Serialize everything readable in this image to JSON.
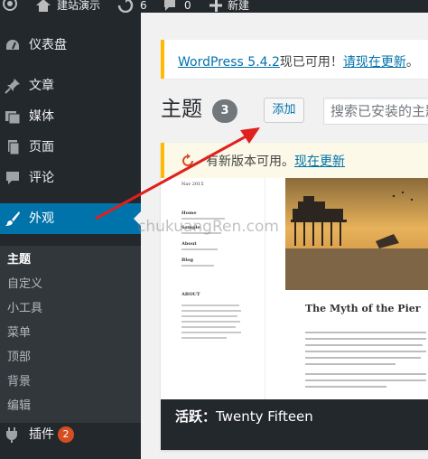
{
  "admin_bar": {
    "site_name": "建站演示",
    "updates_count": "6",
    "comments_count": "0",
    "new_label": "新建"
  },
  "sidebar": {
    "dashboard": "仪表盘",
    "posts": "文章",
    "media": "媒体",
    "pages": "页面",
    "comments": "评论",
    "appearance": "外观",
    "submenu": [
      "主题",
      "自定义",
      "小工具",
      "菜单",
      "顶部",
      "背景",
      "编辑"
    ],
    "plugins": "插件",
    "plugins_badge": "2"
  },
  "notice": {
    "link_version": "WordPress 5.4.2",
    "text_middle": "现已可用！",
    "link_update": "请现在更新",
    "text_end": "。"
  },
  "page": {
    "title": "主题",
    "count": "3",
    "add_button": "添加",
    "search_placeholder": "搜索已安装的主题..."
  },
  "theme_card": {
    "update_text": "有新版本可用。",
    "update_link": "现在更新",
    "screenshot": {
      "sidebar_texts": [
        "Nav 2015",
        "Home",
        "Sample",
        "About",
        "Blog",
        "ABOUT"
      ],
      "post_title": "The Myth of the Pier"
    },
    "active_label": "活跃：",
    "theme_name": "Twenty Fifteen"
  },
  "watermark": "chukuangRen.com",
  "colors": {
    "admin_dark": "#23282d",
    "accent_blue": "#0073aa",
    "notice_yellow": "#ffb900",
    "badge_orange": "#d54e21",
    "arrow_red": "#e0201c"
  }
}
